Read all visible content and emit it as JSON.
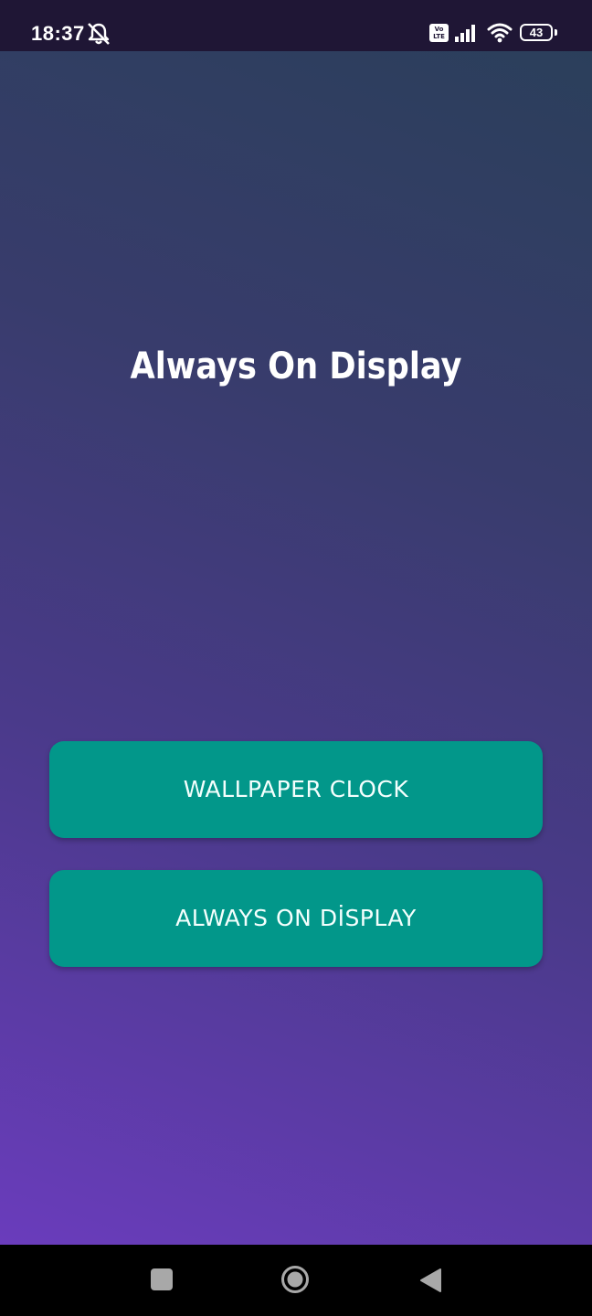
{
  "status_bar": {
    "time": "18:37",
    "volte": "Vo\nLTE",
    "battery": "43",
    "icons": [
      "bell-off-icon",
      "volte-icon",
      "signal-icon",
      "wifi-icon",
      "battery-icon"
    ]
  },
  "main": {
    "title": "Always On Display",
    "buttons": [
      {
        "label": "WALLPAPER CLOCK"
      },
      {
        "label": "ALWAYS ON DİSPLAY"
      }
    ],
    "colors": {
      "button_bg": "#02978a",
      "gradient_top": "#2b3f5b",
      "gradient_bottom": "#6a3cbc"
    }
  },
  "nav_bar": {
    "icons": [
      "recents-icon",
      "home-icon",
      "back-icon"
    ]
  }
}
